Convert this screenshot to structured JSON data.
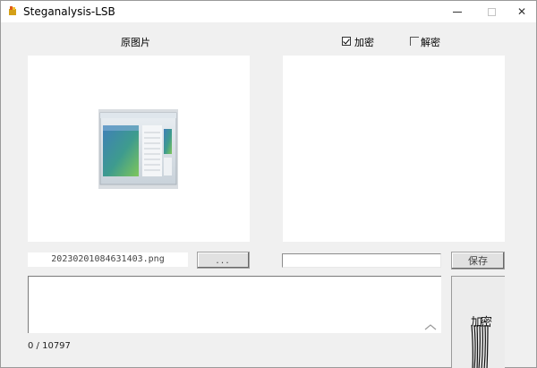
{
  "window": {
    "title": "Steganalysis-LSB",
    "controls": {
      "minimize": "minimize",
      "maximize": "maximize",
      "close": "✕"
    }
  },
  "left": {
    "label": "原图片",
    "filename": "20230201084631403.png",
    "browse_label": "..."
  },
  "right": {
    "encrypt_label": "加密",
    "decrypt_label": "解密",
    "encrypt_checked": true,
    "decrypt_checked": false,
    "save_label": "保存"
  },
  "message": {
    "counter": "0 / 10797"
  },
  "side_button": {
    "label": "加密"
  },
  "icons": {
    "app": "app-icon",
    "preview": "image-placeholder-icon"
  }
}
